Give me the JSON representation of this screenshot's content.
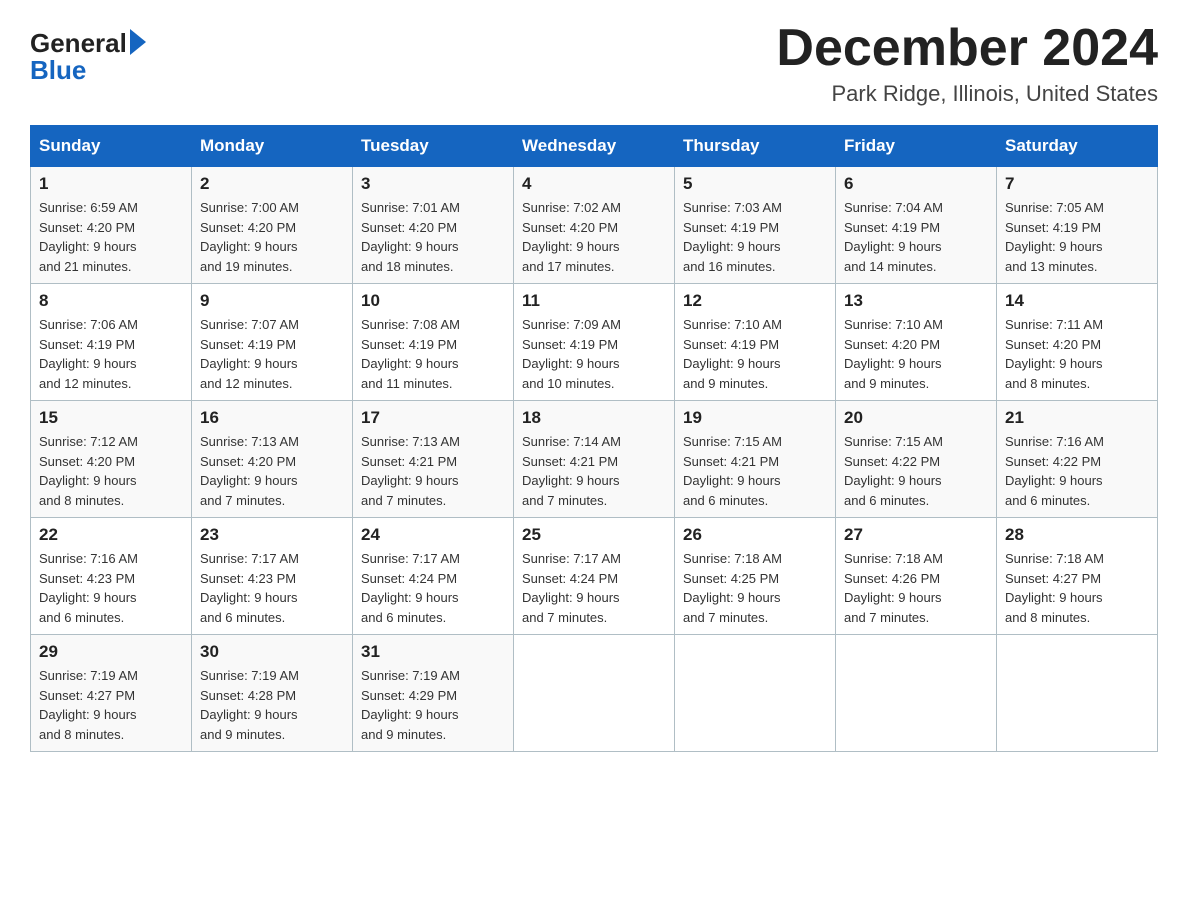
{
  "header": {
    "month": "December 2024",
    "location": "Park Ridge, Illinois, United States",
    "logo_general": "General",
    "logo_blue": "Blue"
  },
  "days_of_week": [
    "Sunday",
    "Monday",
    "Tuesday",
    "Wednesday",
    "Thursday",
    "Friday",
    "Saturday"
  ],
  "weeks": [
    [
      {
        "num": "1",
        "sunrise": "6:59 AM",
        "sunset": "4:20 PM",
        "daylight": "9 hours and 21 minutes."
      },
      {
        "num": "2",
        "sunrise": "7:00 AM",
        "sunset": "4:20 PM",
        "daylight": "9 hours and 19 minutes."
      },
      {
        "num": "3",
        "sunrise": "7:01 AM",
        "sunset": "4:20 PM",
        "daylight": "9 hours and 18 minutes."
      },
      {
        "num": "4",
        "sunrise": "7:02 AM",
        "sunset": "4:20 PM",
        "daylight": "9 hours and 17 minutes."
      },
      {
        "num": "5",
        "sunrise": "7:03 AM",
        "sunset": "4:19 PM",
        "daylight": "9 hours and 16 minutes."
      },
      {
        "num": "6",
        "sunrise": "7:04 AM",
        "sunset": "4:19 PM",
        "daylight": "9 hours and 14 minutes."
      },
      {
        "num": "7",
        "sunrise": "7:05 AM",
        "sunset": "4:19 PM",
        "daylight": "9 hours and 13 minutes."
      }
    ],
    [
      {
        "num": "8",
        "sunrise": "7:06 AM",
        "sunset": "4:19 PM",
        "daylight": "9 hours and 12 minutes."
      },
      {
        "num": "9",
        "sunrise": "7:07 AM",
        "sunset": "4:19 PM",
        "daylight": "9 hours and 12 minutes."
      },
      {
        "num": "10",
        "sunrise": "7:08 AM",
        "sunset": "4:19 PM",
        "daylight": "9 hours and 11 minutes."
      },
      {
        "num": "11",
        "sunrise": "7:09 AM",
        "sunset": "4:19 PM",
        "daylight": "9 hours and 10 minutes."
      },
      {
        "num": "12",
        "sunrise": "7:10 AM",
        "sunset": "4:19 PM",
        "daylight": "9 hours and 9 minutes."
      },
      {
        "num": "13",
        "sunrise": "7:10 AM",
        "sunset": "4:20 PM",
        "daylight": "9 hours and 9 minutes."
      },
      {
        "num": "14",
        "sunrise": "7:11 AM",
        "sunset": "4:20 PM",
        "daylight": "9 hours and 8 minutes."
      }
    ],
    [
      {
        "num": "15",
        "sunrise": "7:12 AM",
        "sunset": "4:20 PM",
        "daylight": "9 hours and 8 minutes."
      },
      {
        "num": "16",
        "sunrise": "7:13 AM",
        "sunset": "4:20 PM",
        "daylight": "9 hours and 7 minutes."
      },
      {
        "num": "17",
        "sunrise": "7:13 AM",
        "sunset": "4:21 PM",
        "daylight": "9 hours and 7 minutes."
      },
      {
        "num": "18",
        "sunrise": "7:14 AM",
        "sunset": "4:21 PM",
        "daylight": "9 hours and 7 minutes."
      },
      {
        "num": "19",
        "sunrise": "7:15 AM",
        "sunset": "4:21 PM",
        "daylight": "9 hours and 6 minutes."
      },
      {
        "num": "20",
        "sunrise": "7:15 AM",
        "sunset": "4:22 PM",
        "daylight": "9 hours and 6 minutes."
      },
      {
        "num": "21",
        "sunrise": "7:16 AM",
        "sunset": "4:22 PM",
        "daylight": "9 hours and 6 minutes."
      }
    ],
    [
      {
        "num": "22",
        "sunrise": "7:16 AM",
        "sunset": "4:23 PM",
        "daylight": "9 hours and 6 minutes."
      },
      {
        "num": "23",
        "sunrise": "7:17 AM",
        "sunset": "4:23 PM",
        "daylight": "9 hours and 6 minutes."
      },
      {
        "num": "24",
        "sunrise": "7:17 AM",
        "sunset": "4:24 PM",
        "daylight": "9 hours and 6 minutes."
      },
      {
        "num": "25",
        "sunrise": "7:17 AM",
        "sunset": "4:24 PM",
        "daylight": "9 hours and 7 minutes."
      },
      {
        "num": "26",
        "sunrise": "7:18 AM",
        "sunset": "4:25 PM",
        "daylight": "9 hours and 7 minutes."
      },
      {
        "num": "27",
        "sunrise": "7:18 AM",
        "sunset": "4:26 PM",
        "daylight": "9 hours and 7 minutes."
      },
      {
        "num": "28",
        "sunrise": "7:18 AM",
        "sunset": "4:27 PM",
        "daylight": "9 hours and 8 minutes."
      }
    ],
    [
      {
        "num": "29",
        "sunrise": "7:19 AM",
        "sunset": "4:27 PM",
        "daylight": "9 hours and 8 minutes."
      },
      {
        "num": "30",
        "sunrise": "7:19 AM",
        "sunset": "4:28 PM",
        "daylight": "9 hours and 9 minutes."
      },
      {
        "num": "31",
        "sunrise": "7:19 AM",
        "sunset": "4:29 PM",
        "daylight": "9 hours and 9 minutes."
      },
      null,
      null,
      null,
      null
    ]
  ],
  "labels": {
    "sunrise": "Sunrise:",
    "sunset": "Sunset:",
    "daylight": "Daylight:"
  }
}
